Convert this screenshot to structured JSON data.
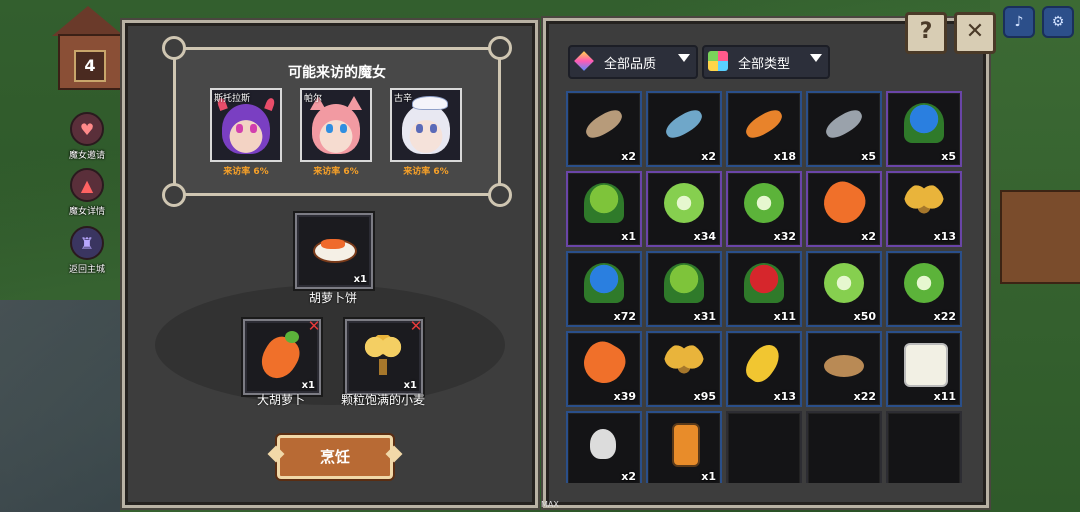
{
  "hud": {
    "house_level": "4",
    "side_buttons": [
      {
        "label": "魔女邀请",
        "icon": "heart-icon"
      },
      {
        "label": "魔女详情",
        "icon": "witch-hat-icon"
      },
      {
        "label": "返回主城",
        "icon": "castle-icon"
      }
    ]
  },
  "witches": {
    "title": "可能来访的魔女",
    "list": [
      {
        "name": "斯托拉斯",
        "rate": "来访率 6%",
        "hair": "#7a3fc2",
        "skin": "#f3d3c4",
        "eye": "#d23fae"
      },
      {
        "name": "帕尔",
        "rate": "来访率 6%",
        "hair": "#f29aa2",
        "skin": "#f6dcd0",
        "eye": "#2f8ee0"
      },
      {
        "name": "古辛",
        "rate": "来访率 6%",
        "hair": "#e8e8f2",
        "skin": "#f5e2da",
        "eye": "#5a6ab8"
      }
    ]
  },
  "recipe": {
    "result": {
      "name": "胡萝卜饼",
      "count": "x1",
      "icon": "carrot-cake-icon"
    },
    "ingredients": [
      {
        "name": "大胡萝卜",
        "count": "x1",
        "icon": "carrot-icon"
      },
      {
        "name": "颗粒饱满的小麦",
        "count": "x1",
        "icon": "wheat-icon"
      }
    ],
    "cook_label": "烹饪"
  },
  "filters": {
    "quality_label": "全部品质",
    "type_label": "全部类型"
  },
  "inventory": [
    [
      {
        "icon": "catfish-icon",
        "count": "x2",
        "color": "#b79b7a",
        "frame": "blue"
      },
      {
        "icon": "blue-fish-icon",
        "count": "x2",
        "color": "#6fa7c9",
        "frame": "blue"
      },
      {
        "icon": "goldfish-icon",
        "count": "x18",
        "color": "#e8832b",
        "frame": "blue"
      },
      {
        "icon": "grey-fish-icon",
        "count": "x5",
        "color": "#9aa2ab",
        "frame": "blue"
      },
      {
        "icon": "blue-flower-icon",
        "count": "x5",
        "color": "#2a7fe0",
        "frame": "purple"
      }
    ],
    [
      {
        "icon": "green-flower-icon",
        "count": "x1",
        "color": "#7ec43a",
        "frame": "purple"
      },
      {
        "icon": "cabbage-icon",
        "count": "x34",
        "color": "#86cf4f",
        "frame": "purple"
      },
      {
        "icon": "lettuce-icon",
        "count": "x32",
        "color": "#5cb33a",
        "frame": "purple"
      },
      {
        "icon": "carrot-icon",
        "count": "x2",
        "color": "#f0702a",
        "frame": "purple"
      },
      {
        "icon": "wheat-icon",
        "count": "x13",
        "color": "#e9b43b",
        "frame": "purple"
      }
    ],
    [
      {
        "icon": "blue-flower-icon",
        "count": "x72",
        "color": "#2a7fe0",
        "frame": "blue"
      },
      {
        "icon": "green-flower-icon",
        "count": "x31",
        "color": "#7ec43a",
        "frame": "blue"
      },
      {
        "icon": "red-flower-icon",
        "count": "x11",
        "color": "#d6262c",
        "frame": "blue"
      },
      {
        "icon": "cabbage-icon",
        "count": "x50",
        "color": "#86cf4f",
        "frame": "blue"
      },
      {
        "icon": "lettuce-icon",
        "count": "x22",
        "color": "#5cb33a",
        "frame": "blue"
      }
    ],
    [
      {
        "icon": "carrot-icon",
        "count": "x39",
        "color": "#f0702a",
        "frame": "blue"
      },
      {
        "icon": "wheat-icon",
        "count": "x95",
        "color": "#e9b43b",
        "frame": "blue"
      },
      {
        "icon": "corn-icon",
        "count": "x13",
        "color": "#f1c631",
        "frame": "blue"
      },
      {
        "icon": "potato-icon",
        "count": "x22",
        "color": "#b98a55",
        "frame": "blue"
      },
      {
        "icon": "milk-jar-icon",
        "count": "x11",
        "color": "#f2f0e4",
        "frame": "blue"
      }
    ],
    [
      {
        "icon": "potion-flask-icon",
        "count": "x2",
        "color": "#dcdcdc",
        "frame": "blue"
      },
      {
        "icon": "honey-bottle-icon",
        "count": "x1",
        "color": "#e88c2a",
        "frame": "blue"
      },
      {
        "icon": "",
        "count": "",
        "color": "",
        "frame": "empty"
      },
      {
        "icon": "",
        "count": "",
        "color": "",
        "frame": "empty"
      },
      {
        "icon": "",
        "count": "",
        "color": "",
        "frame": "empty"
      }
    ]
  ],
  "top_buttons": {
    "help": "?",
    "close": "✕"
  },
  "footer": {
    "max_label": "MAX"
  }
}
